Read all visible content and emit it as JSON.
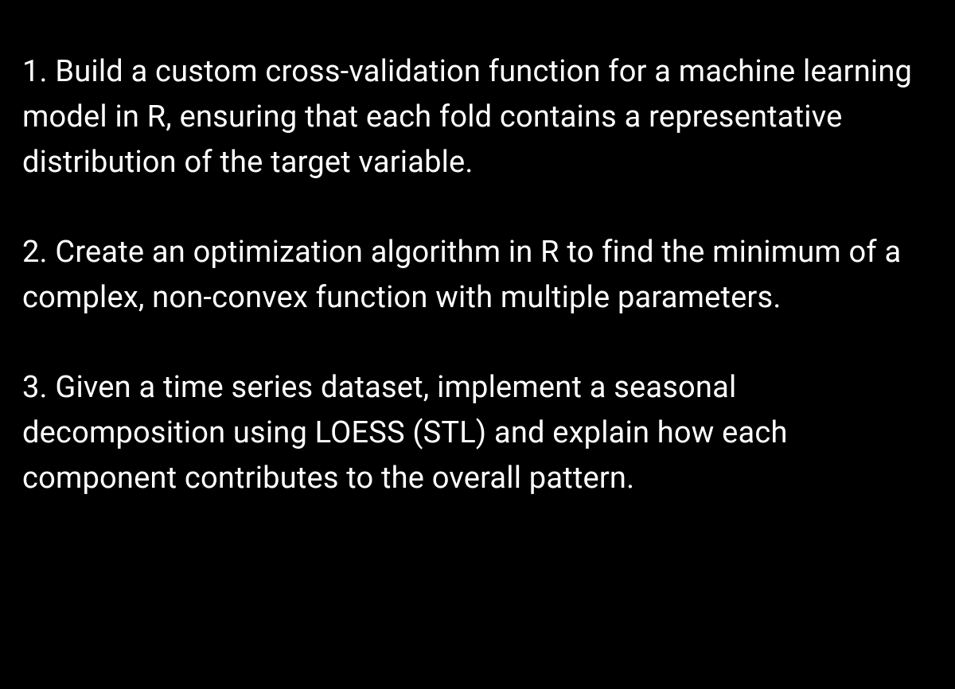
{
  "items": [
    "1. Build a custom cross-validation function for a machine learning model in R, ensuring that each fold contains a representative distribution of the target variable.",
    "2. Create an optimization algorithm in R to find the minimum of a complex, non-convex function with multiple parameters.",
    "3. Given a time series dataset, implement a seasonal decomposition using LOESS (STL) and explain how each component contributes to the overall pattern."
  ]
}
